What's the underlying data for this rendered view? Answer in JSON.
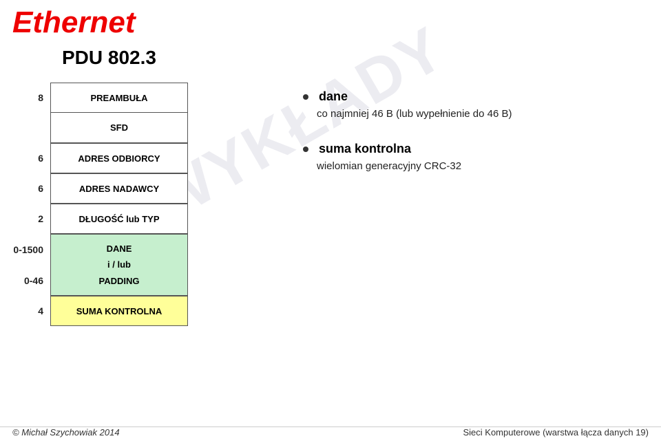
{
  "title": "Ethernet",
  "pdu_title": "PDU 802.3",
  "watermark": "WYKŁADY",
  "table": {
    "rows": [
      {
        "label": "8",
        "cell_text": "PREAMBUŁA",
        "bg": "white"
      },
      {
        "label": "",
        "cell_text": "SFD",
        "bg": "white"
      },
      {
        "label": "6",
        "cell_text": "ADRES ODBIORCY",
        "bg": "white"
      },
      {
        "label": "6",
        "cell_text": "ADRES NADAWCY",
        "bg": "white"
      },
      {
        "label": "2",
        "cell_text": "DŁUGOŚĆ lub TYP",
        "bg": "white"
      }
    ],
    "merged_labels": [
      "0-1500",
      "0-46"
    ],
    "merged_cell_lines": [
      "DANE",
      "i / lub",
      "PADDING"
    ],
    "merged_cell_bg": "green",
    "last_row_label": "4",
    "last_row_text": "SUMA KONTROLNA",
    "last_row_bg": "yellow"
  },
  "bullets": [
    {
      "main": "dane",
      "sub": "co najmniej 46 B (lub wypełnienie do 46 B)"
    },
    {
      "main": "suma kontrolna",
      "sub": "wielomian generacyjny CRC-32"
    }
  ],
  "footer": {
    "left_symbol": "©",
    "left_author": "Michał Szychowiak",
    "left_year": "2014",
    "right_text": "Sieci Komputerowe (warstwa łącza danych 19)"
  }
}
